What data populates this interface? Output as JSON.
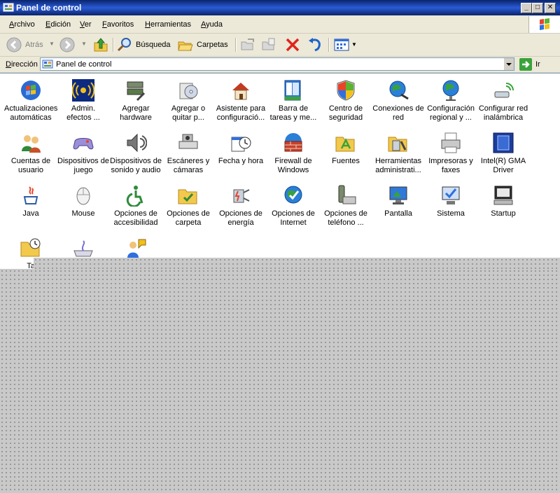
{
  "window": {
    "title": "Panel de control"
  },
  "caption_buttons": {
    "minimize": "_",
    "maximize": "□",
    "close": "✕"
  },
  "menu": [
    {
      "u": "A",
      "rest": "rchivo"
    },
    {
      "u": "E",
      "rest": "dición"
    },
    {
      "u": "V",
      "rest": "er"
    },
    {
      "u": "F",
      "rest": "avoritos"
    },
    {
      "u": "H",
      "rest": "erramientas"
    },
    {
      "u": "A",
      "rest": "yuda"
    }
  ],
  "toolbar": {
    "back_label": "Atrás",
    "search_label": "Búsqueda",
    "folders_label": "Carpetas"
  },
  "address": {
    "label_u": "D",
    "label_rest": "irección",
    "value": "Panel de control",
    "go_label": "Ir"
  },
  "items": [
    {
      "label": "Actualizaciones\nautomáticas",
      "icon": "windows-update-icon"
    },
    {
      "label": "Admin.\nefectos ...",
      "icon": "effects-admin-icon"
    },
    {
      "label": "Agregar\nhardware",
      "icon": "add-hardware-icon"
    },
    {
      "label": "Agregar o\nquitar p...",
      "icon": "add-remove-programs-icon"
    },
    {
      "label": "Asistente para\nconfiguració...",
      "icon": "network-setup-wizard-icon"
    },
    {
      "label": "Barra de\ntareas y me...",
      "icon": "taskbar-start-menu-icon"
    },
    {
      "label": "Centro de\nseguridad",
      "icon": "security-center-icon"
    },
    {
      "label": "Conexiones de\nred",
      "icon": "network-connections-icon"
    },
    {
      "label": "Configuración\nregional y ...",
      "icon": "regional-settings-icon"
    },
    {
      "label": "Configurar red\ninalámbrica",
      "icon": "wireless-network-icon"
    },
    {
      "label": "Cuentas de\nusuario",
      "icon": "user-accounts-icon"
    },
    {
      "label": "Dispositivos de\njuego",
      "icon": "game-controllers-icon"
    },
    {
      "label": "Dispositivos de\nsonido y audio",
      "icon": "sound-devices-icon"
    },
    {
      "label": "Escáneres y\ncámaras",
      "icon": "scanners-cameras-icon"
    },
    {
      "label": "Fecha y hora",
      "icon": "date-time-icon"
    },
    {
      "label": "Firewall de\nWindows",
      "icon": "firewall-icon"
    },
    {
      "label": "Fuentes",
      "icon": "fonts-folder-icon"
    },
    {
      "label": "Herramientas\nadministrati...",
      "icon": "admin-tools-icon"
    },
    {
      "label": "Impresoras y\nfaxes",
      "icon": "printers-faxes-icon"
    },
    {
      "label": "Intel(R) GMA\nDriver",
      "icon": "intel-gma-icon"
    },
    {
      "label": "Java",
      "icon": "java-icon"
    },
    {
      "label": "Mouse",
      "icon": "mouse-icon"
    },
    {
      "label": "Opciones de\naccesibilidad",
      "icon": "accessibility-icon"
    },
    {
      "label": "Opciones de\ncarpeta",
      "icon": "folder-options-icon"
    },
    {
      "label": "Opciones de\nenergía",
      "icon": "power-options-icon"
    },
    {
      "label": "Opciones de\nInternet",
      "icon": "internet-options-icon"
    },
    {
      "label": "Opciones de\nteléfono ...",
      "icon": "phone-modem-icon"
    },
    {
      "label": "Pantalla",
      "icon": "display-icon"
    },
    {
      "label": "Sistema",
      "icon": "system-icon"
    },
    {
      "label": "Startup",
      "icon": "startup-icon"
    },
    {
      "label": "Ta",
      "icon": "scheduled-tasks-icon"
    },
    {
      "label": "",
      "icon": "keyboard-icon"
    },
    {
      "label": "",
      "icon": "user-group-icon"
    }
  ]
}
